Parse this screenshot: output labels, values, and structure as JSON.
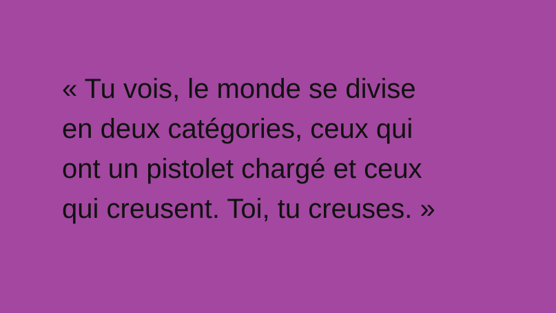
{
  "background_color": "#a347a0",
  "text_color": "#111111",
  "quote": {
    "lines": [
      "« Tu vois, le monde se divise",
      "en deux catégories, ceux qui",
      "ont un pistolet chargé et ceux",
      "qui creusent. Toi, tu creuses. »"
    ]
  }
}
